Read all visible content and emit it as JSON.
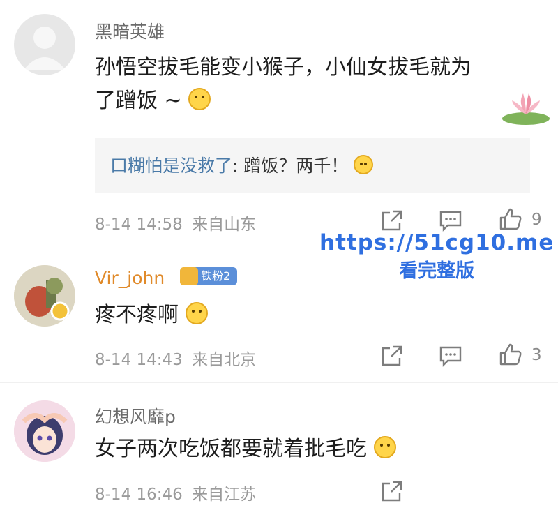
{
  "comments": [
    {
      "username": "黑暗英雄",
      "content_line1": "孙悟空拔毛能变小猴子，小仙女拔毛就为",
      "content_line2": "了蹭饭 ~",
      "reply": {
        "user": "口糊怕是没救了",
        "text": ": 蹭饭？两千！"
      },
      "time": "8-14 14:58",
      "location": "来自山东",
      "likes": "9"
    },
    {
      "username": "Vir_john",
      "badge": "铁粉2",
      "content": "疼不疼啊",
      "time": "8-14 14:43",
      "location": "来自北京",
      "likes": "3"
    },
    {
      "username": "幻想风靡p",
      "content": "女子两次吃饭都要就着批毛吃",
      "time": "8-14 16:46",
      "location": "来自江苏"
    }
  ],
  "watermark": {
    "line1": "https://51cg10.me",
    "line2": "看完整版"
  },
  "icons": [
    "avatar-placeholder-icon",
    "share-icon",
    "comment-icon",
    "like-icon",
    "crown-icon",
    "emoji-icon",
    "lotus-icon"
  ]
}
